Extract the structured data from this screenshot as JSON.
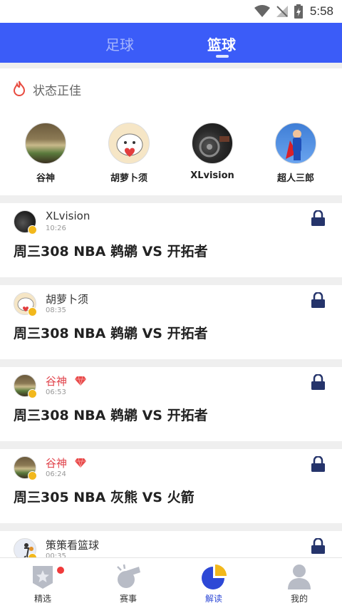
{
  "status_bar": {
    "time": "5:58"
  },
  "top_tabs": [
    {
      "label": "足球",
      "active": false
    },
    {
      "label": "篮球",
      "active": true
    }
  ],
  "hot_section": {
    "title": "状态正佳",
    "experts": [
      {
        "name": "谷神"
      },
      {
        "name": "胡萝卜须"
      },
      {
        "name": "XLvision"
      },
      {
        "name": "超人三郎"
      }
    ]
  },
  "posts": [
    {
      "author": "XLvision",
      "time": "10:26",
      "title": "周三308 NBA 鹈鹕 VS 开拓者",
      "author_highlight": false,
      "gem": false,
      "locked": true
    },
    {
      "author": "胡萝卜须",
      "time": "08:35",
      "title": "周三308 NBA 鹈鹕 VS 开拓者",
      "author_highlight": false,
      "gem": false,
      "locked": true
    },
    {
      "author": "谷神",
      "time": "06:53",
      "title": "周三308 NBA 鹈鹕 VS 开拓者",
      "author_highlight": true,
      "gem": true,
      "locked": true
    },
    {
      "author": "谷神",
      "time": "06:24",
      "title": "周三305 NBA 灰熊 VS 火箭",
      "author_highlight": true,
      "gem": true,
      "locked": true
    },
    {
      "author": "策策看篮球",
      "time": "00:35",
      "title": "",
      "author_highlight": false,
      "gem": false,
      "locked": true
    }
  ],
  "bottom_nav": [
    {
      "label": "精选",
      "icon": "badge-star-icon",
      "active": false,
      "has_dot": true
    },
    {
      "label": "赛事",
      "icon": "whistle-icon",
      "active": false,
      "has_dot": false
    },
    {
      "label": "解读",
      "icon": "pie-chart-icon",
      "active": true,
      "has_dot": false
    },
    {
      "label": "我的",
      "icon": "person-icon",
      "active": false,
      "has_dot": false
    }
  ],
  "colors": {
    "brand_blue": "#3b5cf8",
    "nav_active": "#2d48d6",
    "highlight_red": "#e0424a",
    "lock_navy": "#25346b",
    "badge_yellow": "#f2b81c"
  }
}
